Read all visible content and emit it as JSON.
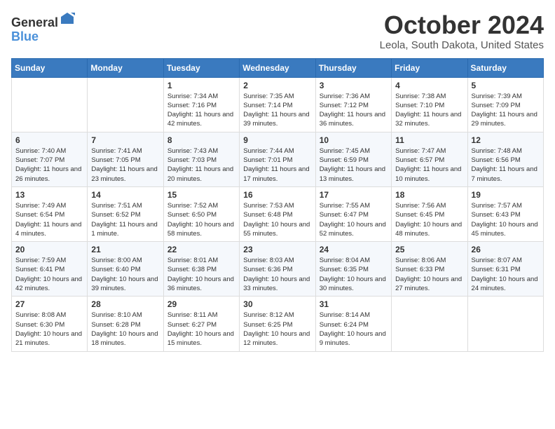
{
  "logo": {
    "general": "General",
    "blue": "Blue"
  },
  "title": "October 2024",
  "subtitle": "Leola, South Dakota, United States",
  "days_of_week": [
    "Sunday",
    "Monday",
    "Tuesday",
    "Wednesday",
    "Thursday",
    "Friday",
    "Saturday"
  ],
  "weeks": [
    [
      {
        "day": null
      },
      {
        "day": null
      },
      {
        "day": "1",
        "sunrise": "Sunrise: 7:34 AM",
        "sunset": "Sunset: 7:16 PM",
        "daylight": "Daylight: 11 hours and 42 minutes."
      },
      {
        "day": "2",
        "sunrise": "Sunrise: 7:35 AM",
        "sunset": "Sunset: 7:14 PM",
        "daylight": "Daylight: 11 hours and 39 minutes."
      },
      {
        "day": "3",
        "sunrise": "Sunrise: 7:36 AM",
        "sunset": "Sunset: 7:12 PM",
        "daylight": "Daylight: 11 hours and 36 minutes."
      },
      {
        "day": "4",
        "sunrise": "Sunrise: 7:38 AM",
        "sunset": "Sunset: 7:10 PM",
        "daylight": "Daylight: 11 hours and 32 minutes."
      },
      {
        "day": "5",
        "sunrise": "Sunrise: 7:39 AM",
        "sunset": "Sunset: 7:09 PM",
        "daylight": "Daylight: 11 hours and 29 minutes."
      }
    ],
    [
      {
        "day": "6",
        "sunrise": "Sunrise: 7:40 AM",
        "sunset": "Sunset: 7:07 PM",
        "daylight": "Daylight: 11 hours and 26 minutes."
      },
      {
        "day": "7",
        "sunrise": "Sunrise: 7:41 AM",
        "sunset": "Sunset: 7:05 PM",
        "daylight": "Daylight: 11 hours and 23 minutes."
      },
      {
        "day": "8",
        "sunrise": "Sunrise: 7:43 AM",
        "sunset": "Sunset: 7:03 PM",
        "daylight": "Daylight: 11 hours and 20 minutes."
      },
      {
        "day": "9",
        "sunrise": "Sunrise: 7:44 AM",
        "sunset": "Sunset: 7:01 PM",
        "daylight": "Daylight: 11 hours and 17 minutes."
      },
      {
        "day": "10",
        "sunrise": "Sunrise: 7:45 AM",
        "sunset": "Sunset: 6:59 PM",
        "daylight": "Daylight: 11 hours and 13 minutes."
      },
      {
        "day": "11",
        "sunrise": "Sunrise: 7:47 AM",
        "sunset": "Sunset: 6:57 PM",
        "daylight": "Daylight: 11 hours and 10 minutes."
      },
      {
        "day": "12",
        "sunrise": "Sunrise: 7:48 AM",
        "sunset": "Sunset: 6:56 PM",
        "daylight": "Daylight: 11 hours and 7 minutes."
      }
    ],
    [
      {
        "day": "13",
        "sunrise": "Sunrise: 7:49 AM",
        "sunset": "Sunset: 6:54 PM",
        "daylight": "Daylight: 11 hours and 4 minutes."
      },
      {
        "day": "14",
        "sunrise": "Sunrise: 7:51 AM",
        "sunset": "Sunset: 6:52 PM",
        "daylight": "Daylight: 11 hours and 1 minute."
      },
      {
        "day": "15",
        "sunrise": "Sunrise: 7:52 AM",
        "sunset": "Sunset: 6:50 PM",
        "daylight": "Daylight: 10 hours and 58 minutes."
      },
      {
        "day": "16",
        "sunrise": "Sunrise: 7:53 AM",
        "sunset": "Sunset: 6:48 PM",
        "daylight": "Daylight: 10 hours and 55 minutes."
      },
      {
        "day": "17",
        "sunrise": "Sunrise: 7:55 AM",
        "sunset": "Sunset: 6:47 PM",
        "daylight": "Daylight: 10 hours and 52 minutes."
      },
      {
        "day": "18",
        "sunrise": "Sunrise: 7:56 AM",
        "sunset": "Sunset: 6:45 PM",
        "daylight": "Daylight: 10 hours and 48 minutes."
      },
      {
        "day": "19",
        "sunrise": "Sunrise: 7:57 AM",
        "sunset": "Sunset: 6:43 PM",
        "daylight": "Daylight: 10 hours and 45 minutes."
      }
    ],
    [
      {
        "day": "20",
        "sunrise": "Sunrise: 7:59 AM",
        "sunset": "Sunset: 6:41 PM",
        "daylight": "Daylight: 10 hours and 42 minutes."
      },
      {
        "day": "21",
        "sunrise": "Sunrise: 8:00 AM",
        "sunset": "Sunset: 6:40 PM",
        "daylight": "Daylight: 10 hours and 39 minutes."
      },
      {
        "day": "22",
        "sunrise": "Sunrise: 8:01 AM",
        "sunset": "Sunset: 6:38 PM",
        "daylight": "Daylight: 10 hours and 36 minutes."
      },
      {
        "day": "23",
        "sunrise": "Sunrise: 8:03 AM",
        "sunset": "Sunset: 6:36 PM",
        "daylight": "Daylight: 10 hours and 33 minutes."
      },
      {
        "day": "24",
        "sunrise": "Sunrise: 8:04 AM",
        "sunset": "Sunset: 6:35 PM",
        "daylight": "Daylight: 10 hours and 30 minutes."
      },
      {
        "day": "25",
        "sunrise": "Sunrise: 8:06 AM",
        "sunset": "Sunset: 6:33 PM",
        "daylight": "Daylight: 10 hours and 27 minutes."
      },
      {
        "day": "26",
        "sunrise": "Sunrise: 8:07 AM",
        "sunset": "Sunset: 6:31 PM",
        "daylight": "Daylight: 10 hours and 24 minutes."
      }
    ],
    [
      {
        "day": "27",
        "sunrise": "Sunrise: 8:08 AM",
        "sunset": "Sunset: 6:30 PM",
        "daylight": "Daylight: 10 hours and 21 minutes."
      },
      {
        "day": "28",
        "sunrise": "Sunrise: 8:10 AM",
        "sunset": "Sunset: 6:28 PM",
        "daylight": "Daylight: 10 hours and 18 minutes."
      },
      {
        "day": "29",
        "sunrise": "Sunrise: 8:11 AM",
        "sunset": "Sunset: 6:27 PM",
        "daylight": "Daylight: 10 hours and 15 minutes."
      },
      {
        "day": "30",
        "sunrise": "Sunrise: 8:12 AM",
        "sunset": "Sunset: 6:25 PM",
        "daylight": "Daylight: 10 hours and 12 minutes."
      },
      {
        "day": "31",
        "sunrise": "Sunrise: 8:14 AM",
        "sunset": "Sunset: 6:24 PM",
        "daylight": "Daylight: 10 hours and 9 minutes."
      },
      {
        "day": null
      },
      {
        "day": null
      }
    ]
  ]
}
